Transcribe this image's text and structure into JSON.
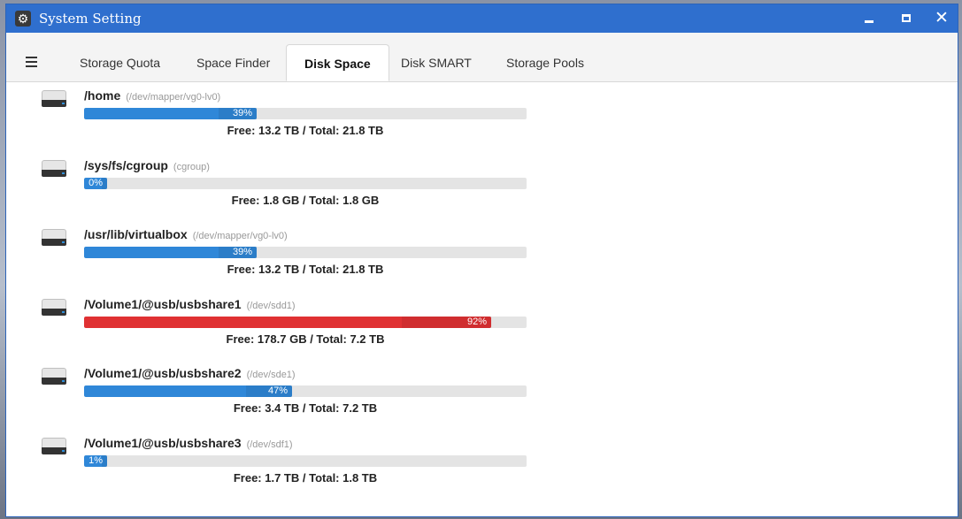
{
  "window": {
    "title": "System Setting",
    "app_icon": "gear-icon",
    "controls": {
      "minimize": "minimize-icon",
      "maximize": "maximize-icon",
      "close": "close-icon"
    }
  },
  "tabs": [
    {
      "label": "Storage Quota",
      "active": false
    },
    {
      "label": "Space Finder",
      "active": false
    },
    {
      "label": "Disk Space",
      "active": true
    },
    {
      "label": "Disk SMART",
      "active": false
    },
    {
      "label": "Storage Pools",
      "active": false
    }
  ],
  "colors": {
    "accent": "#2f87d8",
    "warning": "#e03133",
    "titlebar": "#2f6fce"
  },
  "disks": [
    {
      "mount": "/home",
      "device": "(/dev/mapper/vg0-lv0)",
      "percent": 39,
      "percent_label": "39%",
      "free_text": "Free: 13.2 TB / Total: 21.8 TB"
    },
    {
      "mount": "/sys/fs/cgroup",
      "device": "(cgroup)",
      "percent": 0,
      "percent_label": "0%",
      "free_text": "Free: 1.8 GB / Total: 1.8 GB"
    },
    {
      "mount": "/usr/lib/virtualbox",
      "device": "(/dev/mapper/vg0-lv0)",
      "percent": 39,
      "percent_label": "39%",
      "free_text": "Free: 13.2 TB / Total: 21.8 TB"
    },
    {
      "mount": "/Volume1/@usb/usbshare1",
      "device": "(/dev/sdd1)",
      "percent": 92,
      "percent_label": "92%",
      "free_text": "Free: 178.7 GB / Total: 7.2 TB"
    },
    {
      "mount": "/Volume1/@usb/usbshare2",
      "device": "(/dev/sde1)",
      "percent": 47,
      "percent_label": "47%",
      "free_text": "Free: 3.4 TB / Total: 7.2 TB"
    },
    {
      "mount": "/Volume1/@usb/usbshare3",
      "device": "(/dev/sdf1)",
      "percent": 1,
      "percent_label": "1%",
      "free_text": "Free: 1.7 TB / Total: 1.8 TB"
    }
  ]
}
